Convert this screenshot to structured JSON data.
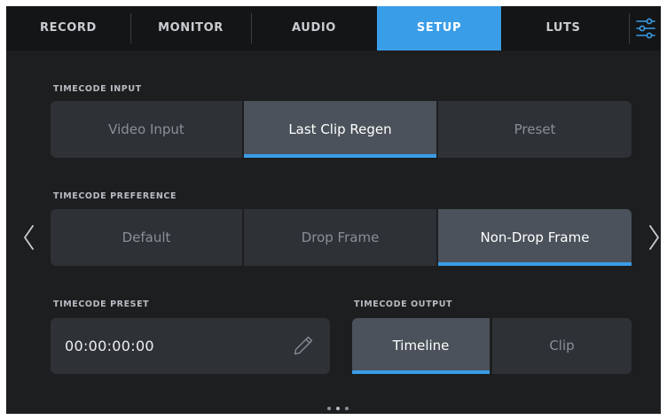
{
  "tabs": [
    {
      "label": "RECORD"
    },
    {
      "label": "MONITOR"
    },
    {
      "label": "AUDIO"
    },
    {
      "label": "SETUP"
    },
    {
      "label": "LUTS"
    }
  ],
  "active_tab": "SETUP",
  "timecode_input": {
    "label": "TIMECODE INPUT",
    "options": [
      "Video Input",
      "Last Clip Regen",
      "Preset"
    ],
    "selected": "Last Clip Regen"
  },
  "timecode_preference": {
    "label": "TIMECODE PREFERENCE",
    "options": [
      "Default",
      "Drop Frame",
      "Non-Drop Frame"
    ],
    "selected": "Non-Drop Frame"
  },
  "timecode_preset": {
    "label": "TIMECODE PRESET",
    "value": "00:00:00:00"
  },
  "timecode_output": {
    "label": "TIMECODE OUTPUT",
    "options": [
      "Timeline",
      "Clip"
    ],
    "selected": "Timeline"
  },
  "pagination": {
    "pages": 3,
    "current": 2
  },
  "colors": {
    "accent": "#3a9de8",
    "background": "#1d1e20",
    "segment": "#2e3237",
    "segment_selected": "#4b525b"
  },
  "icons": {
    "settings": "sliders-icon",
    "edit": "pencil-icon",
    "prev": "chevron-left-icon",
    "next": "chevron-right-icon"
  }
}
